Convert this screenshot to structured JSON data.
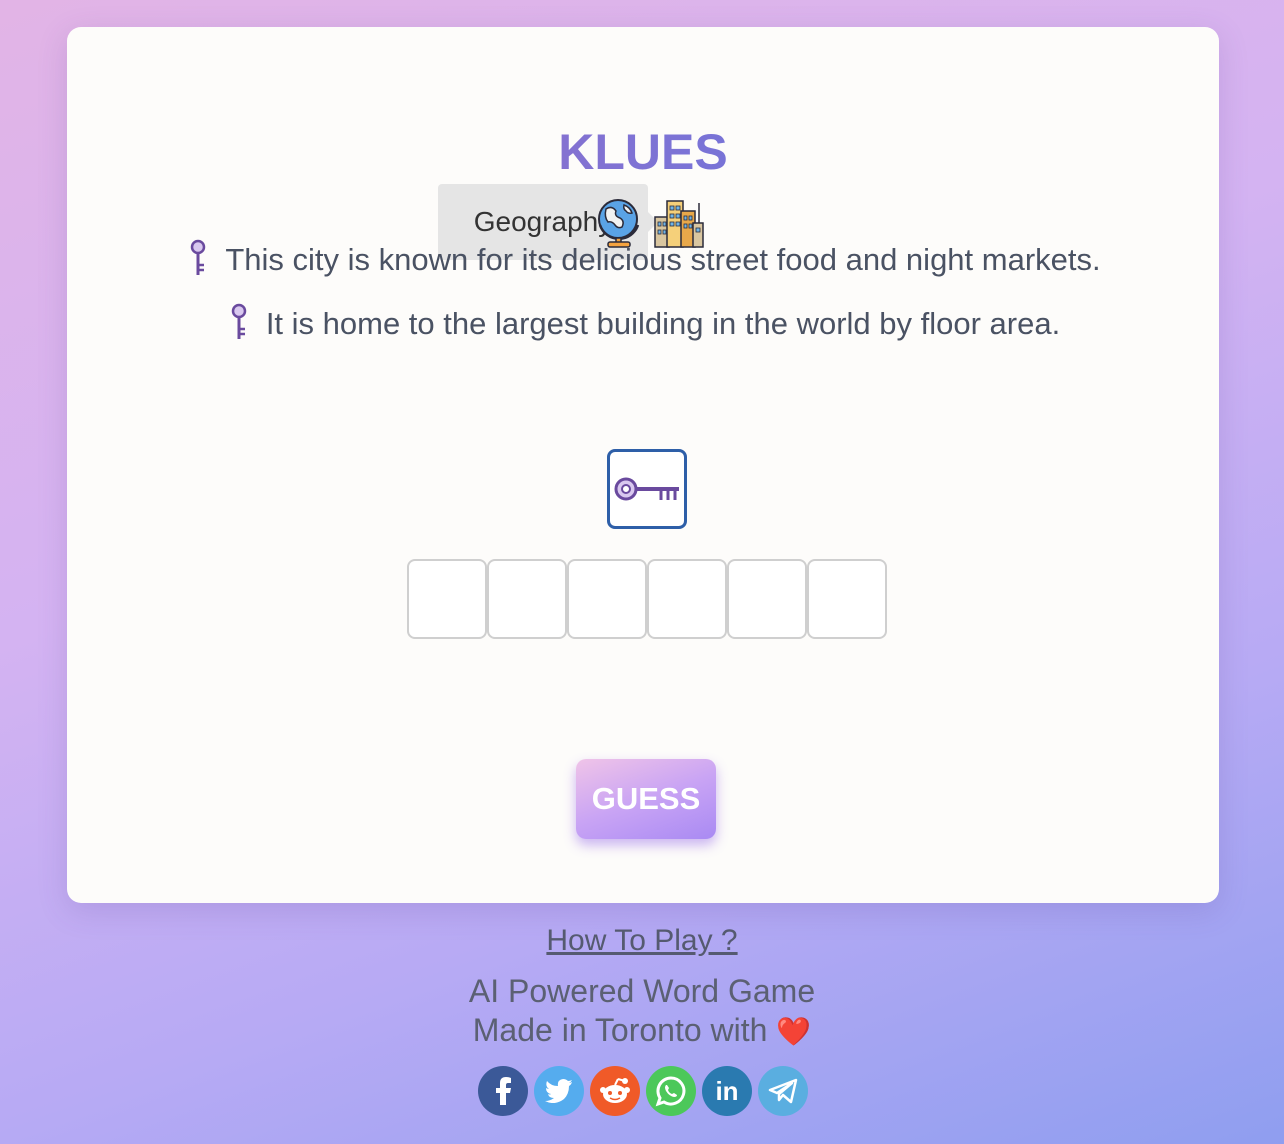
{
  "game": {
    "title": "KLUES",
    "category": "Geography",
    "category_icons": [
      "globe-icon",
      "city-buildings-icon"
    ],
    "clues": [
      "This city is known for its delicious street food and night markets.",
      "It is home to the largest building in the world by floor area."
    ],
    "hint_icon": "key-icon",
    "answer_slots": [
      "",
      "",
      "",
      "",
      "",
      ""
    ],
    "guess_label": "GUESS"
  },
  "footer": {
    "how_to_play": "How To Play ?",
    "tagline": "AI Powered Word Game",
    "made_in": "Made in Toronto with",
    "heart": "❤️"
  },
  "social": [
    {
      "name": "facebook",
      "glyph": "f",
      "color": "#3b5998"
    },
    {
      "name": "twitter",
      "glyph": "t",
      "color": "#55acee"
    },
    {
      "name": "reddit",
      "glyph": "r",
      "color": "#ff5700"
    },
    {
      "name": "whatsapp",
      "glyph": "w",
      "color": "#25d366"
    },
    {
      "name": "linkedin",
      "glyph": "in",
      "color": "#0077b5"
    },
    {
      "name": "telegram",
      "glyph": "tg",
      "color": "#37aee2"
    }
  ]
}
